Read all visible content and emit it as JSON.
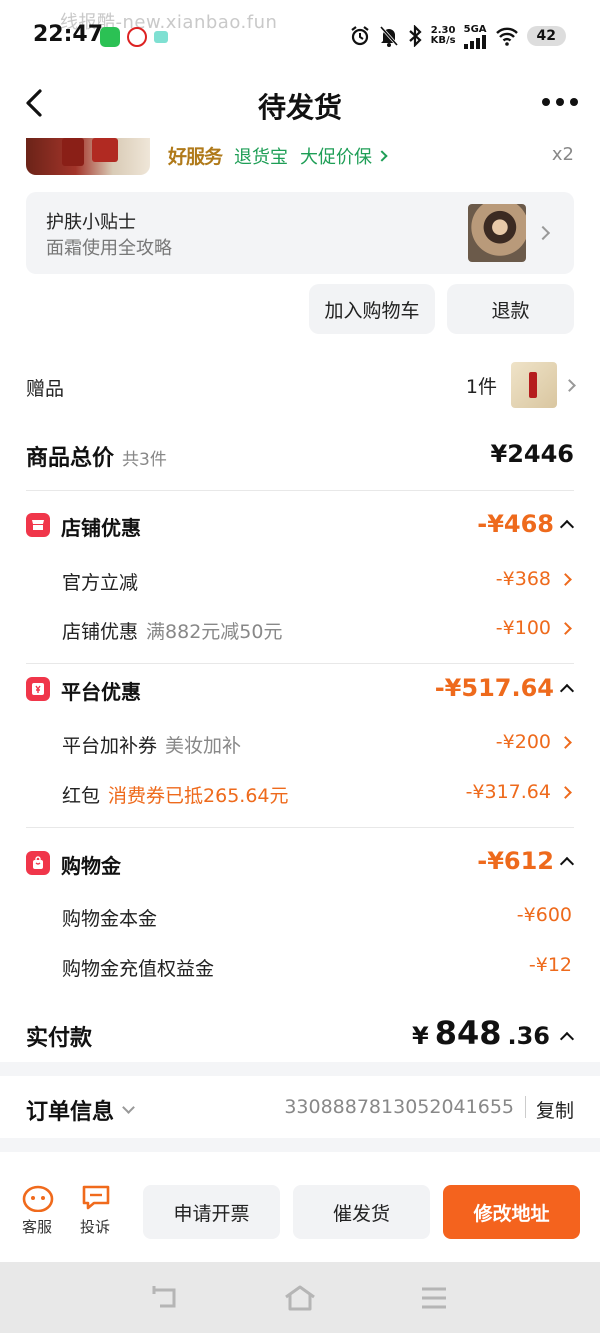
{
  "status_bar": {
    "watermark": "线报酷-new.xianbao.fun",
    "time": "22:47",
    "speed_value": "2.30",
    "speed_unit": "KB/s",
    "signal": "5GA",
    "battery": "42"
  },
  "header": {
    "title": "待发货"
  },
  "product": {
    "service_brand": "好服务",
    "services": [
      "退货宝",
      "大促价保"
    ],
    "quantity": "x2"
  },
  "tip": {
    "title": "护肤小贴士",
    "subtitle": "面霜使用全攻略"
  },
  "actions": {
    "add_to_cart": "加入购物车",
    "refund": "退款"
  },
  "gift": {
    "label": "赠品",
    "count": "1件"
  },
  "total": {
    "label": "商品总价",
    "count": "共3件",
    "value": "¥2446"
  },
  "shop_discount": {
    "title": "店铺优惠",
    "value": "-¥468",
    "items": [
      {
        "label": "官方立减",
        "note": "",
        "value": "-¥368"
      },
      {
        "label": "店铺优惠",
        "note": "满882元减50元",
        "value": "-¥100"
      }
    ]
  },
  "platform_discount": {
    "title": "平台优惠",
    "value": "-¥517.64",
    "items": [
      {
        "label": "平台加补券",
        "note": "美妆加补",
        "value": "-¥200"
      },
      {
        "label": "红包",
        "note": "消费券已抵265.64元",
        "value": "-¥317.64"
      }
    ]
  },
  "shopping_gold": {
    "title": "购物金",
    "value": "-¥612",
    "items": [
      {
        "label": "购物金本金",
        "value": "-¥600"
      },
      {
        "label": "购物金充值权益金",
        "value": "-¥12"
      }
    ]
  },
  "paid": {
    "label": "实付款",
    "currency": "¥",
    "integer": "848",
    "decimal": ".36"
  },
  "order_info": {
    "label": "订单信息",
    "number": "3308887813052041655",
    "copy": "复制"
  },
  "bottom_bar": {
    "service": "客服",
    "complaint": "投诉",
    "invoice": "申请开票",
    "urge": "催发货",
    "modify_address": "修改地址"
  },
  "colors": {
    "accent_orange": "#ee6a1c",
    "badge_red": "#f0364a",
    "service_green": "#1e9e56",
    "primary_button": "#f4631e"
  }
}
